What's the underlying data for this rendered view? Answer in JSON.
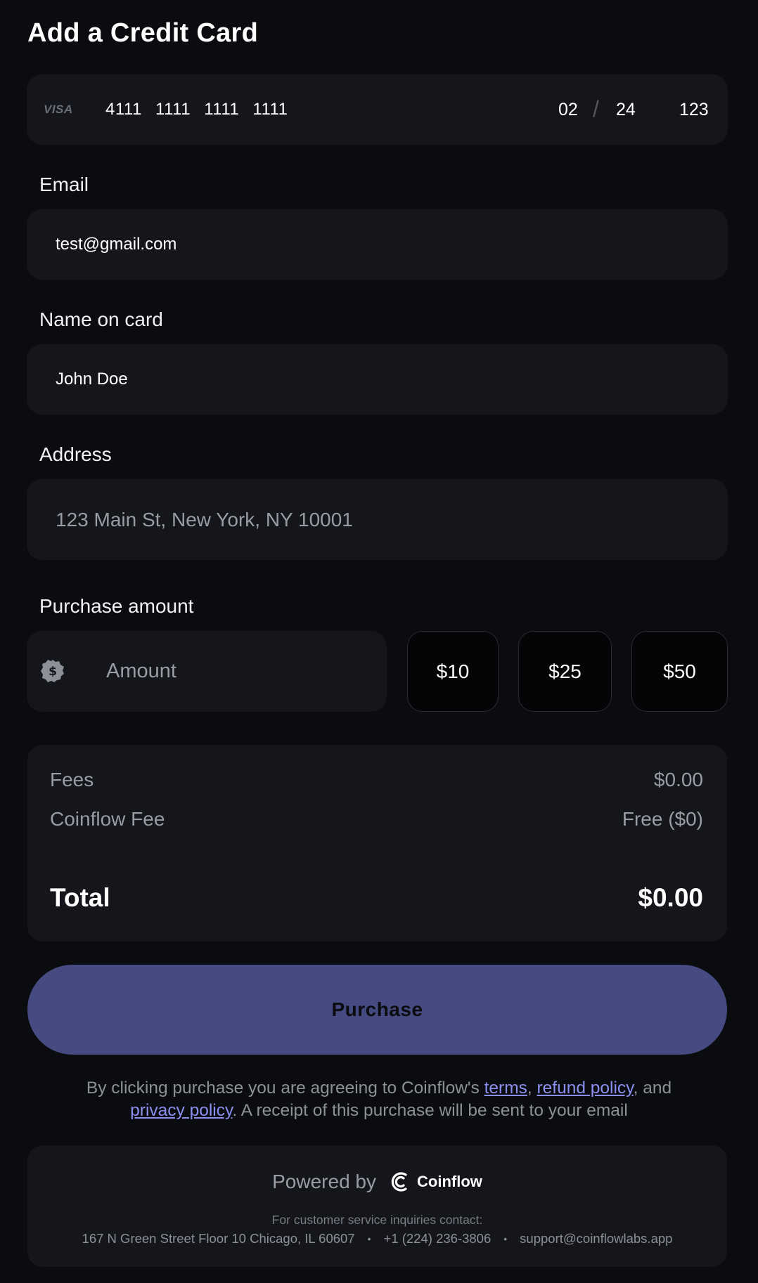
{
  "page": {
    "title": "Add a Credit Card"
  },
  "card": {
    "brand": "VISA",
    "number": "4111 1111 1111 1111",
    "exp_month": "02",
    "exp_separator": "/",
    "exp_year": "24",
    "cvc": "123"
  },
  "email": {
    "label": "Email",
    "value": "test@gmail.com"
  },
  "name_on_card": {
    "label": "Name on card",
    "value": "John Doe"
  },
  "address": {
    "label": "Address",
    "placeholder": "123 Main St, New York, NY 10001"
  },
  "purchase_amount": {
    "label": "Purchase amount",
    "placeholder": "Amount",
    "icon": "dollar-badge-icon",
    "quick_amounts": [
      "$10",
      "$25",
      "$50"
    ]
  },
  "summary": {
    "fees_label": "Fees",
    "fees_value": "$0.00",
    "coinflow_fee_label": "Coinflow Fee",
    "coinflow_fee_value": "Free ($0)",
    "total_label": "Total",
    "total_value": "$0.00"
  },
  "purchase_button": {
    "label": "Purchase",
    "color": "#454a80"
  },
  "legal": {
    "prefix": "By clicking purchase you are agreeing to Coinflow's ",
    "terms": "terms",
    "sep1": ", ",
    "refund_policy": "refund policy",
    "sep2": ", and ",
    "privacy_policy": "privacy policy",
    "suffix": ". A receipt of this purchase will be sent to your email",
    "link_color": "#8a8ff0"
  },
  "footer": {
    "powered_by": "Powered by",
    "brand": "Coinflow",
    "contact_heading": "For customer service inquiries contact:",
    "address": "167 N Green Street Floor 10 Chicago, IL 60607",
    "phone": "+1 (224) 236-3806",
    "email": "support@coinflowlabs.app",
    "separator": "•"
  }
}
